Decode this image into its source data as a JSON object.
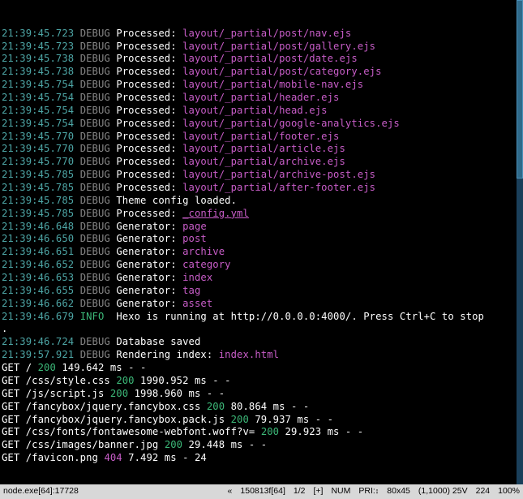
{
  "debug_lines": [
    {
      "ts": "21:39:45.723",
      "lvl": "DEBUG",
      "pre": "Processed: ",
      "val": "layout/_partial/post/nav.ejs",
      "cls": "path"
    },
    {
      "ts": "21:39:45.723",
      "lvl": "DEBUG",
      "pre": "Processed: ",
      "val": "layout/_partial/post/gallery.ejs",
      "cls": "path"
    },
    {
      "ts": "21:39:45.738",
      "lvl": "DEBUG",
      "pre": "Processed: ",
      "val": "layout/_partial/post/date.ejs",
      "cls": "path"
    },
    {
      "ts": "21:39:45.738",
      "lvl": "DEBUG",
      "pre": "Processed: ",
      "val": "layout/_partial/post/category.ejs",
      "cls": "path"
    },
    {
      "ts": "21:39:45.754",
      "lvl": "DEBUG",
      "pre": "Processed: ",
      "val": "layout/_partial/mobile-nav.ejs",
      "cls": "path"
    },
    {
      "ts": "21:39:45.754",
      "lvl": "DEBUG",
      "pre": "Processed: ",
      "val": "layout/_partial/header.ejs",
      "cls": "path"
    },
    {
      "ts": "21:39:45.754",
      "lvl": "DEBUG",
      "pre": "Processed: ",
      "val": "layout/_partial/head.ejs",
      "cls": "path"
    },
    {
      "ts": "21:39:45.754",
      "lvl": "DEBUG",
      "pre": "Processed: ",
      "val": "layout/_partial/google-analytics.ejs",
      "cls": "path"
    },
    {
      "ts": "21:39:45.770",
      "lvl": "DEBUG",
      "pre": "Processed: ",
      "val": "layout/_partial/footer.ejs",
      "cls": "path"
    },
    {
      "ts": "21:39:45.770",
      "lvl": "DEBUG",
      "pre": "Processed: ",
      "val": "layout/_partial/article.ejs",
      "cls": "path"
    },
    {
      "ts": "21:39:45.770",
      "lvl": "DEBUG",
      "pre": "Processed: ",
      "val": "layout/_partial/archive.ejs",
      "cls": "path"
    },
    {
      "ts": "21:39:45.785",
      "lvl": "DEBUG",
      "pre": "Processed: ",
      "val": "layout/_partial/archive-post.ejs",
      "cls": "path"
    },
    {
      "ts": "21:39:45.785",
      "lvl": "DEBUG",
      "pre": "Processed: ",
      "val": "layout/_partial/after-footer.ejs",
      "cls": "path"
    },
    {
      "ts": "21:39:45.785",
      "lvl": "DEBUG",
      "pre": "Theme config loaded.",
      "val": "",
      "cls": ""
    },
    {
      "ts": "21:39:45.785",
      "lvl": "DEBUG",
      "pre": "Processed: ",
      "val": "_config.yml",
      "cls": "path underline"
    },
    {
      "ts": "21:39:46.648",
      "lvl": "DEBUG",
      "pre": "Generator: ",
      "val": "page",
      "cls": "path"
    },
    {
      "ts": "21:39:46.650",
      "lvl": "DEBUG",
      "pre": "Generator: ",
      "val": "post",
      "cls": "path"
    },
    {
      "ts": "21:39:46.651",
      "lvl": "DEBUG",
      "pre": "Generator: ",
      "val": "archive",
      "cls": "path"
    },
    {
      "ts": "21:39:46.652",
      "lvl": "DEBUG",
      "pre": "Generator: ",
      "val": "category",
      "cls": "path"
    },
    {
      "ts": "21:39:46.653",
      "lvl": "DEBUG",
      "pre": "Generator: ",
      "val": "index",
      "cls": "path"
    },
    {
      "ts": "21:39:46.655",
      "lvl": "DEBUG",
      "pre": "Generator: ",
      "val": "tag",
      "cls": "path"
    },
    {
      "ts": "21:39:46.662",
      "lvl": "DEBUG",
      "pre": "Generator: ",
      "val": "asset",
      "cls": "path"
    }
  ],
  "info_line": {
    "ts": "21:39:46.679",
    "lvl": "INFO",
    "txt": "Hexo is running at http://0.0.0.0:4000/. Press Ctrl+C to stop"
  },
  "info_cont": ".",
  "post_lines": [
    {
      "ts": "21:39:46.724",
      "lvl": "DEBUG",
      "pre": "Database saved",
      "val": "",
      "cls": ""
    },
    {
      "ts": "21:39:57.921",
      "lvl": "DEBUG",
      "pre": "Rendering index: ",
      "val": "index.html",
      "cls": "path"
    }
  ],
  "http_lines": [
    {
      "method": "GET",
      "path": "/",
      "status": "200",
      "status_cls": "status-ok",
      "rest": "149.642 ms - -"
    },
    {
      "method": "GET",
      "path": "/css/style.css",
      "status": "200",
      "status_cls": "status-ok",
      "rest": "1990.952 ms - -"
    },
    {
      "method": "GET",
      "path": "/js/script.js",
      "status": "200",
      "status_cls": "status-ok",
      "rest": "1998.960 ms - -"
    },
    {
      "method": "GET",
      "path": "/fancybox/jquery.fancybox.css",
      "status": "200",
      "status_cls": "status-ok",
      "rest": "80.864 ms - -"
    },
    {
      "method": "GET",
      "path": "/fancybox/jquery.fancybox.pack.js",
      "status": "200",
      "status_cls": "status-ok",
      "rest": "79.937 ms - -"
    },
    {
      "method": "GET",
      "path": "/css/fonts/fontawesome-webfont.woff?v=",
      "status": "200",
      "status_cls": "status-ok",
      "rest": "29.923 ms - -"
    },
    {
      "method": "GET",
      "path": "/css/images/banner.jpg",
      "status": "200",
      "status_cls": "status-ok",
      "rest": "29.448 ms - -"
    },
    {
      "method": "GET",
      "path": "/favicon.png",
      "status": "404",
      "status_cls": "status-err",
      "rest": "7.492 ms - 24"
    }
  ],
  "statusbar": {
    "process": "node.exe[64]:17728",
    "sep": "«",
    "filesize": "150813f[64]",
    "ratio": "1/2",
    "plus": "[+]",
    "num": "NUM",
    "pri": "PRI:",
    "dims": "80x45",
    "pos": "(1,1000) 25V",
    "count": "224",
    "pct": "100%"
  }
}
